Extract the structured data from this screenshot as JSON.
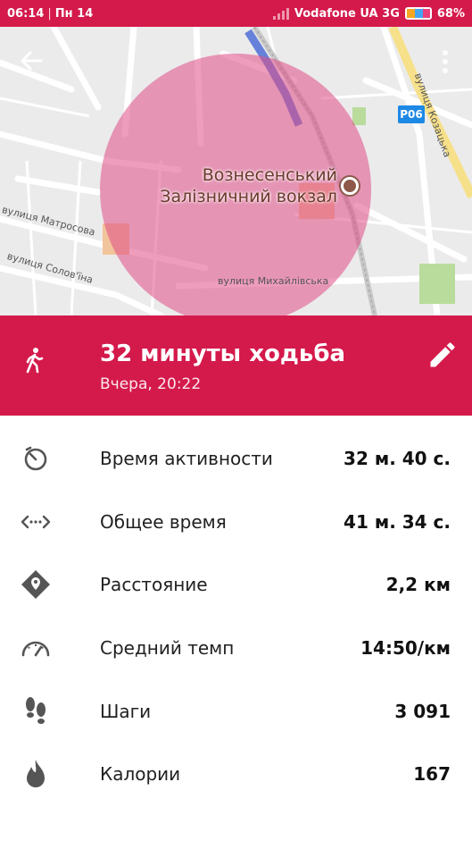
{
  "status_bar": {
    "time": "06:14",
    "separator": "|",
    "day": "Пн 14",
    "carrier": "Vodafone UA 3G",
    "battery": "68%"
  },
  "map": {
    "station_name_line1": "Вознесенський",
    "station_name_line2": "Залізничний вокзал",
    "road_badge": "Р06",
    "street_kozatska": "вулиця Козацька",
    "street_matrosova": "вулиця Матросова",
    "street_solovina": "вулиця Солов'їна",
    "street_mykhailivska": "вулиця Михайлівська",
    "back_icon": "arrow-left-icon",
    "menu_icon": "more-vert-icon"
  },
  "activity": {
    "title": "32 минуты ходьба",
    "subtitle": "Вчера, 20:22",
    "type_icon": "walking-icon",
    "edit_icon": "pencil-icon",
    "accent_color": "#d4194b"
  },
  "stats": [
    {
      "icon": "timer-icon",
      "label": "Время активности",
      "value": "32 м. 40 с."
    },
    {
      "icon": "duration-arrows-icon",
      "label": "Общее время",
      "value": "41 м. 34 с."
    },
    {
      "icon": "distance-pin-icon",
      "label": "Расстояние",
      "value": "2,2 км"
    },
    {
      "icon": "speedometer-icon",
      "label": "Средний темп",
      "value": "14:50/км"
    },
    {
      "icon": "footsteps-icon",
      "label": "Шаги",
      "value": "3 091"
    },
    {
      "icon": "flame-icon",
      "label": "Калории",
      "value": "167"
    }
  ]
}
